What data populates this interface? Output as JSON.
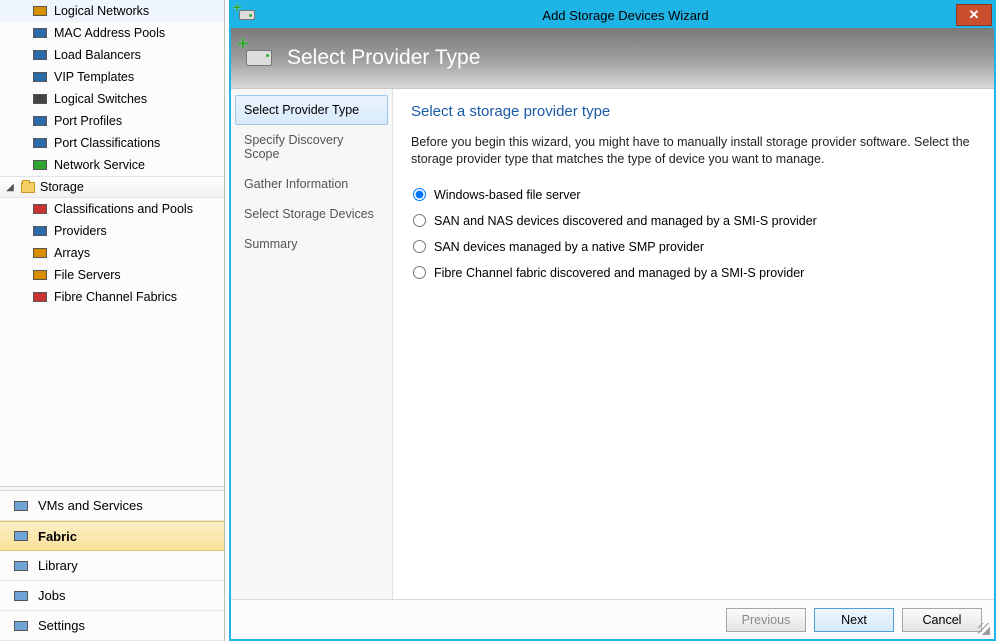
{
  "nav": {
    "tree_top": [
      {
        "label": "Logical Networks",
        "iconColor": "#d88f00"
      },
      {
        "label": "MAC Address Pools",
        "iconColor": "#2b6aa8"
      },
      {
        "label": "Load Balancers",
        "iconColor": "#2b6aa8"
      },
      {
        "label": "VIP Templates",
        "iconColor": "#2b6aa8"
      },
      {
        "label": "Logical Switches",
        "iconColor": "#444"
      },
      {
        "label": "Port Profiles",
        "iconColor": "#2b6aa8"
      },
      {
        "label": "Port Classifications",
        "iconColor": "#2b6aa8"
      },
      {
        "label": "Network Service",
        "iconColor": "#2fa52f"
      }
    ],
    "storage_header": "Storage",
    "tree_storage": [
      {
        "label": "Classifications and Pools",
        "iconColor": "#cc3333"
      },
      {
        "label": "Providers",
        "iconColor": "#2b6aa8"
      },
      {
        "label": "Arrays",
        "iconColor": "#d88f00"
      },
      {
        "label": "File Servers",
        "iconColor": "#d88f00"
      },
      {
        "label": "Fibre Channel Fabrics",
        "iconColor": "#cc3333"
      }
    ],
    "bottom": [
      {
        "label": "VMs and Services",
        "selected": false
      },
      {
        "label": "Fabric",
        "selected": true
      },
      {
        "label": "Library",
        "selected": false
      },
      {
        "label": "Jobs",
        "selected": false
      },
      {
        "label": "Settings",
        "selected": false
      }
    ]
  },
  "wizard": {
    "window_title": "Add Storage Devices Wizard",
    "header_title": "Select Provider Type",
    "steps": [
      {
        "label": "Select Provider Type",
        "active": true
      },
      {
        "label": "Specify Discovery Scope",
        "active": false
      },
      {
        "label": "Gather Information",
        "active": false
      },
      {
        "label": "Select Storage Devices",
        "active": false
      },
      {
        "label": "Summary",
        "active": false
      }
    ],
    "content": {
      "heading": "Select a storage provider type",
      "intro": "Before you begin this wizard, you might have to manually install storage provider software. Select the storage provider type that matches the type of device you want to manage.",
      "options": [
        {
          "label": "Windows-based file server",
          "checked": true
        },
        {
          "label": "SAN and NAS devices discovered and managed by a SMI-S provider",
          "checked": false
        },
        {
          "label": "SAN devices managed by a native SMP provider",
          "checked": false
        },
        {
          "label": "Fibre Channel fabric discovered and managed by a SMI-S provider",
          "checked": false
        }
      ]
    },
    "footer": {
      "previous": "Previous",
      "next": "Next",
      "cancel": "Cancel"
    },
    "close_glyph": "✕"
  }
}
